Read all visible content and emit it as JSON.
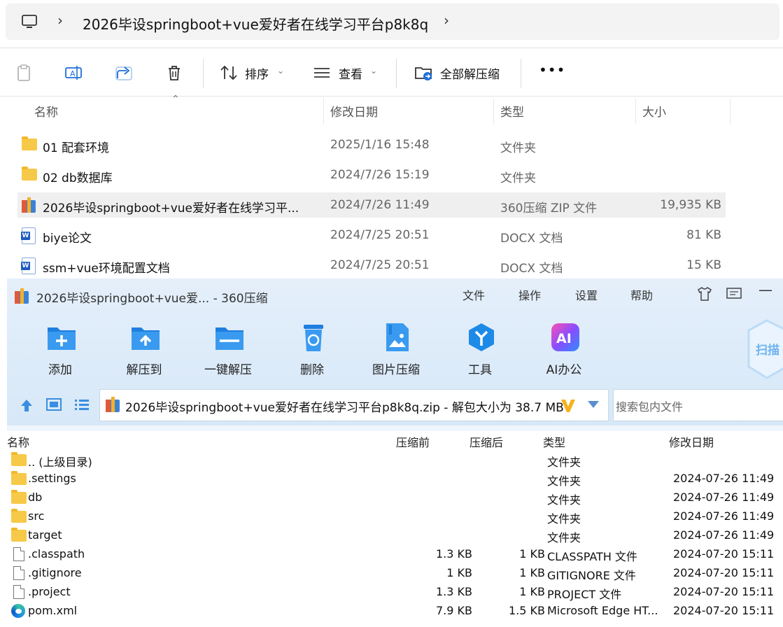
{
  "explorer": {
    "breadcrumb": "2026毕设springboot+vue爱好者在线学习平台p8k8q",
    "toolbar": {
      "sort": "排序",
      "view": "查看",
      "extract_all": "全部解压缩",
      "more": "•••"
    },
    "columns": {
      "name": "名称",
      "date": "修改日期",
      "type": "类型",
      "size": "大小"
    },
    "rows": [
      {
        "name": "01 配套环境",
        "date": "2025/1/16 15:48",
        "type": "文件夹",
        "size": "",
        "icon": "folder-icon"
      },
      {
        "name": "02 db数据库",
        "date": "2024/7/26 15:19",
        "type": "文件夹",
        "size": "",
        "icon": "folder-icon"
      },
      {
        "name": "2026毕设springboot+vue爱好者在线学习平...",
        "date": "2024/7/26 11:49",
        "type": "360压缩 ZIP 文件",
        "size": "19,935 KB",
        "icon": "zip-icon",
        "selected": true
      },
      {
        "name": "biye论文",
        "date": "2024/7/25 20:51",
        "type": "DOCX 文档",
        "size": "81 KB",
        "icon": "word-icon"
      },
      {
        "name": "ssm+vue环境配置文档",
        "date": "2024/7/25 20:51",
        "type": "DOCX 文档",
        "size": "15 KB",
        "icon": "word-icon"
      }
    ]
  },
  "zip_window": {
    "title": "2026毕设springboot+vue爱... - 360压缩",
    "menu": [
      "文件",
      "操作",
      "设置",
      "帮助"
    ],
    "tools": [
      "添加",
      "解压到",
      "一键解压",
      "删除",
      "图片压缩",
      "工具",
      "AI办公"
    ],
    "scan_label": "扫描",
    "address": "2026毕设springboot+vue爱好者在线学习平台p8k8q.zip - 解包大小为 38.7 MB",
    "search_placeholder": "搜索包内文件",
    "columns": {
      "name": "名称",
      "before": "压缩前",
      "after": "压缩后",
      "type": "类型",
      "date": "修改日期"
    },
    "rows": [
      {
        "name": ".. (上级目录)",
        "before": "",
        "after": "",
        "type": "文件夹",
        "date": "",
        "icon": "folder-icon"
      },
      {
        "name": ".settings",
        "before": "",
        "after": "",
        "type": "文件夹",
        "date": "2024-07-26 11:49",
        "icon": "folder-icon"
      },
      {
        "name": "db",
        "before": "",
        "after": "",
        "type": "文件夹",
        "date": "2024-07-26 11:49",
        "icon": "folder-icon"
      },
      {
        "name": "src",
        "before": "",
        "after": "",
        "type": "文件夹",
        "date": "2024-07-26 11:49",
        "icon": "folder-icon"
      },
      {
        "name": "target",
        "before": "",
        "after": "",
        "type": "文件夹",
        "date": "2024-07-26 11:49",
        "icon": "folder-icon"
      },
      {
        "name": ".classpath",
        "before": "1.3 KB",
        "after": "1 KB",
        "type": "CLASSPATH 文件",
        "date": "2024-07-20 15:11",
        "icon": "file-icon"
      },
      {
        "name": ".gitignore",
        "before": "1 KB",
        "after": "1 KB",
        "type": "GITIGNORE 文件",
        "date": "2024-07-20 15:11",
        "icon": "file-icon"
      },
      {
        "name": ".project",
        "before": "1.3 KB",
        "after": "1 KB",
        "type": "PROJECT 文件",
        "date": "2024-07-20 15:11",
        "icon": "file-icon"
      },
      {
        "name": "pom.xml",
        "before": "7.9 KB",
        "after": "1.5 KB",
        "type": "Microsoft Edge HT...",
        "date": "2024-07-20 15:11",
        "icon": "edge-icon"
      }
    ]
  }
}
